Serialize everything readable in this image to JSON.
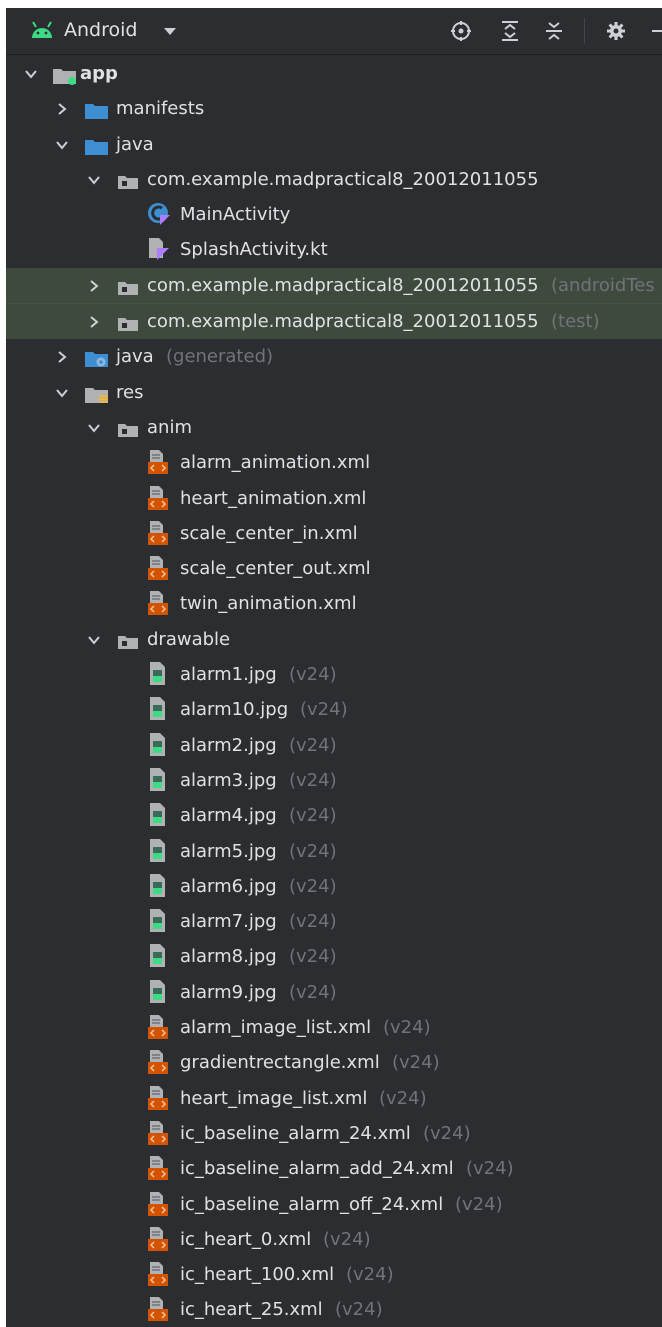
{
  "toolbar": {
    "title": "Android",
    "icons": [
      "locate-icon",
      "expand-all-icon",
      "collapse-all-icon",
      "gear-icon",
      "minimize-icon"
    ]
  },
  "colors": {
    "background": "#2b2d30",
    "text": "#dfe1e5",
    "secondary_text": "#6f737a",
    "highlight_row": "#3e4a3d",
    "folder_blue": "#3d8fd1",
    "xml_orange": "#d35400",
    "android_green": "#3ddc84"
  },
  "tree": [
    {
      "depth": 0,
      "expanded": true,
      "icon": "module-folder-icon",
      "label": "app",
      "suffix": "",
      "bold": true
    },
    {
      "depth": 1,
      "expanded": false,
      "icon": "folder-icon",
      "label": "manifests",
      "suffix": ""
    },
    {
      "depth": 1,
      "expanded": true,
      "icon": "folder-icon",
      "label": "java",
      "suffix": ""
    },
    {
      "depth": 2,
      "expanded": true,
      "icon": "package-icon",
      "label": "com.example.madpractical8_20012011055",
      "suffix": ""
    },
    {
      "depth": 3,
      "icon": "kotlin-class-icon",
      "label": "MainActivity",
      "suffix": ""
    },
    {
      "depth": 3,
      "icon": "kotlin-file-icon",
      "label": "SplashActivity.kt",
      "suffix": ""
    },
    {
      "depth": 2,
      "expanded": false,
      "icon": "package-icon",
      "label": "com.example.madpractical8_20012011055",
      "suffix": "(androidTes",
      "highlight": true
    },
    {
      "depth": 2,
      "expanded": false,
      "icon": "package-icon",
      "label": "com.example.madpractical8_20012011055",
      "suffix": "(test)",
      "highlight": true
    },
    {
      "depth": 1,
      "expanded": false,
      "icon": "generated-folder-icon",
      "label": "java",
      "suffix": "(generated)"
    },
    {
      "depth": 1,
      "expanded": true,
      "icon": "res-folder-icon",
      "label": "res",
      "suffix": ""
    },
    {
      "depth": 2,
      "expanded": true,
      "icon": "package-icon",
      "label": "anim",
      "suffix": ""
    },
    {
      "depth": 3,
      "icon": "xml-file-icon",
      "label": "alarm_animation.xml",
      "suffix": ""
    },
    {
      "depth": 3,
      "icon": "xml-file-icon",
      "label": "heart_animation.xml",
      "suffix": ""
    },
    {
      "depth": 3,
      "icon": "xml-file-icon",
      "label": "scale_center_in.xml",
      "suffix": ""
    },
    {
      "depth": 3,
      "icon": "xml-file-icon",
      "label": "scale_center_out.xml",
      "suffix": ""
    },
    {
      "depth": 3,
      "icon": "xml-file-icon",
      "label": "twin_animation.xml",
      "suffix": ""
    },
    {
      "depth": 2,
      "expanded": true,
      "icon": "package-icon",
      "label": "drawable",
      "suffix": ""
    },
    {
      "depth": 3,
      "icon": "image-file-icon",
      "label": "alarm1.jpg",
      "suffix": "(v24)"
    },
    {
      "depth": 3,
      "icon": "image-file-icon",
      "label": "alarm10.jpg",
      "suffix": "(v24)"
    },
    {
      "depth": 3,
      "icon": "image-file-icon",
      "label": "alarm2.jpg",
      "suffix": "(v24)"
    },
    {
      "depth": 3,
      "icon": "image-file-icon",
      "label": "alarm3.jpg",
      "suffix": "(v24)"
    },
    {
      "depth": 3,
      "icon": "image-file-icon",
      "label": "alarm4.jpg",
      "suffix": "(v24)"
    },
    {
      "depth": 3,
      "icon": "image-file-icon",
      "label": "alarm5.jpg",
      "suffix": "(v24)"
    },
    {
      "depth": 3,
      "icon": "image-file-icon",
      "label": "alarm6.jpg",
      "suffix": "(v24)"
    },
    {
      "depth": 3,
      "icon": "image-file-icon",
      "label": "alarm7.jpg",
      "suffix": "(v24)"
    },
    {
      "depth": 3,
      "icon": "image-file-icon",
      "label": "alarm8.jpg",
      "suffix": "(v24)"
    },
    {
      "depth": 3,
      "icon": "image-file-icon",
      "label": "alarm9.jpg",
      "suffix": "(v24)"
    },
    {
      "depth": 3,
      "icon": "xml-file-icon",
      "label": "alarm_image_list.xml",
      "suffix": "(v24)"
    },
    {
      "depth": 3,
      "icon": "xml-file-icon",
      "label": "gradientrectangle.xml",
      "suffix": "(v24)"
    },
    {
      "depth": 3,
      "icon": "xml-file-icon",
      "label": "heart_image_list.xml",
      "suffix": "(v24)"
    },
    {
      "depth": 3,
      "icon": "xml-file-icon",
      "label": "ic_baseline_alarm_24.xml",
      "suffix": "(v24)"
    },
    {
      "depth": 3,
      "icon": "xml-file-icon",
      "label": "ic_baseline_alarm_add_24.xml",
      "suffix": "(v24)"
    },
    {
      "depth": 3,
      "icon": "xml-file-icon",
      "label": "ic_baseline_alarm_off_24.xml",
      "suffix": "(v24)"
    },
    {
      "depth": 3,
      "icon": "xml-file-icon",
      "label": "ic_heart_0.xml",
      "suffix": "(v24)"
    },
    {
      "depth": 3,
      "icon": "xml-file-icon",
      "label": "ic_heart_100.xml",
      "suffix": "(v24)"
    },
    {
      "depth": 3,
      "icon": "xml-file-icon",
      "label": "ic_heart_25.xml",
      "suffix": "(v24)"
    }
  ]
}
